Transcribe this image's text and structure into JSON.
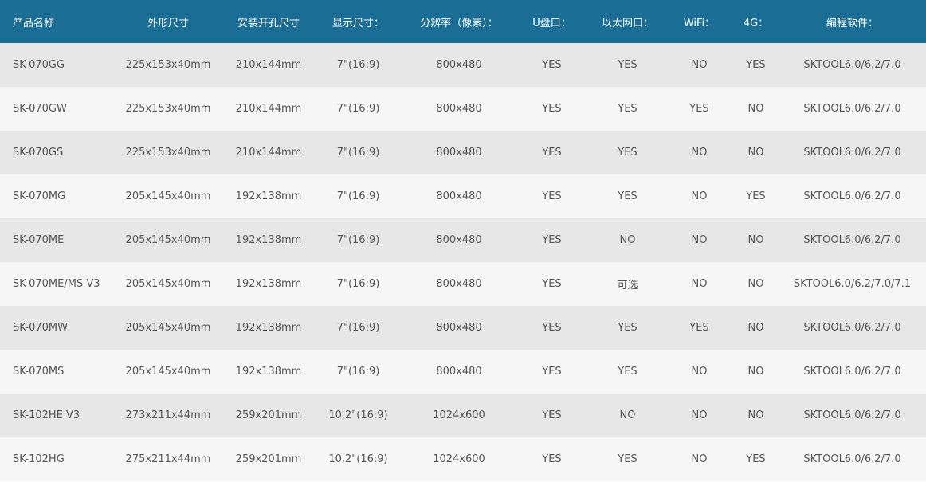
{
  "colors": {
    "header_bg": "#1a6e96",
    "header_text": "#ffffff",
    "row_odd_bg": "#e7e7e7",
    "row_even_bg": "#f6f6f6",
    "cell_text": "#555555"
  },
  "table": {
    "headers": [
      "产品名称",
      "外形尺寸",
      "安装开孔尺寸",
      "显示尺寸：",
      "分辨率（像素）：",
      "U盘口：",
      "以太网口：",
      "WiFi：",
      "4G：",
      "编程软件："
    ],
    "rows": [
      [
        "SK-070GG",
        "225x153x40mm",
        "210x144mm",
        "7\"(16:9)",
        "800x480",
        "YES",
        "YES",
        "NO",
        "YES",
        "SKTOOL6.0/6.2/7.0"
      ],
      [
        "SK-070GW",
        "225x153x40mm",
        "210x144mm",
        "7\"(16:9)",
        "800x480",
        "YES",
        "YES",
        "YES",
        "NO",
        "SKTOOL6.0/6.2/7.0"
      ],
      [
        "SK-070GS",
        "225x153x40mm",
        "210x144mm",
        "7\"(16:9)",
        "800x480",
        "YES",
        "YES",
        "NO",
        "NO",
        "SKTOOL6.0/6.2/7.0"
      ],
      [
        "SK-070MG",
        "205x145x40mm",
        "192x138mm",
        "7\"(16:9)",
        "800x480",
        "YES",
        "YES",
        "NO",
        "YES",
        "SKTOOL6.0/6.2/7.0"
      ],
      [
        "SK-070ME",
        "205x145x40mm",
        "192x138mm",
        "7\"(16:9)",
        "800x480",
        "YES",
        "NO",
        "NO",
        "NO",
        "SKTOOL6.0/6.2/7.0"
      ],
      [
        "SK-070ME/MS V3",
        "205x145x40mm",
        "192x138mm",
        "7\"(16:9)",
        "800x480",
        "YES",
        "可选",
        "NO",
        "NO",
        "SKTOOL6.0/6.2/7.0/7.1"
      ],
      [
        "SK-070MW",
        "205x145x40mm",
        "192x138mm",
        "7\"(16:9)",
        "800x480",
        "YES",
        "YES",
        "YES",
        "NO",
        "SKTOOL6.0/6.2/7.0"
      ],
      [
        "SK-070MS",
        "205x145x40mm",
        "192x138mm",
        "7\"(16:9)",
        "800x480",
        "YES",
        "YES",
        "NO",
        "NO",
        "SKTOOL6.0/6.2/7.0"
      ],
      [
        "SK-102HE V3",
        "273x211x44mm",
        "259x201mm",
        "10.2\"(16:9)",
        "1024x600",
        "YES",
        "NO",
        "NO",
        "NO",
        "SKTOOL6.0/6.2/7.0"
      ],
      [
        "SK-102HG",
        "275x211x44mm",
        "259x201mm",
        "10.2\"(16:9)",
        "1024x600",
        "YES",
        "YES",
        "NO",
        "YES",
        "SKTOOL6.0/6.2/7.0"
      ]
    ]
  }
}
